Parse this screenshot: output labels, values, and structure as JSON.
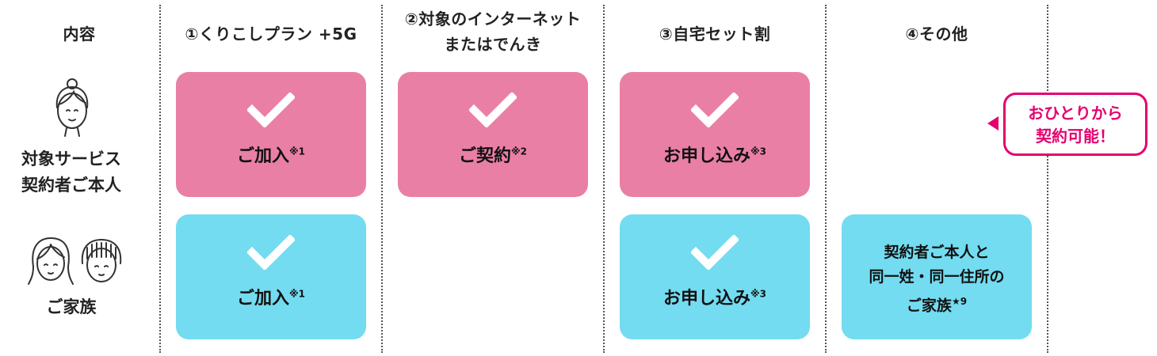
{
  "headers": {
    "content": "内容",
    "col1": "①くりこしプラン +5G",
    "col2_line1": "②対象のインターネット",
    "col2_line2": "またはでんき",
    "col3": "③自宅セット割",
    "col4": "④その他"
  },
  "rows": {
    "self_line1": "対象サービス",
    "self_line2": "契約者ご本人",
    "family": "ご家族"
  },
  "cards": {
    "self_col1": {
      "label": "ご加入",
      "note": "※1"
    },
    "self_col2": {
      "label": "ご契約",
      "note": "※2"
    },
    "self_col3": {
      "label": "お申し込み",
      "note": "※3"
    },
    "family_col1": {
      "label": "ご加入",
      "note": "※1"
    },
    "family_col3": {
      "label": "お申し込み",
      "note": "※3"
    },
    "family_col4": {
      "line1": "契約者ご本人と",
      "line2": "同一姓・同一住所の",
      "line3": "ご家族",
      "note": "★9"
    }
  },
  "callout": {
    "line1": "おひとりから",
    "line2": "契約可能！"
  },
  "colors": {
    "pink": "#ea7fa5",
    "cyan": "#73dcf0",
    "accent": "#e4006e"
  },
  "icons": [
    "check-icon",
    "woman-avatar-icon",
    "family-avatars-icon"
  ]
}
